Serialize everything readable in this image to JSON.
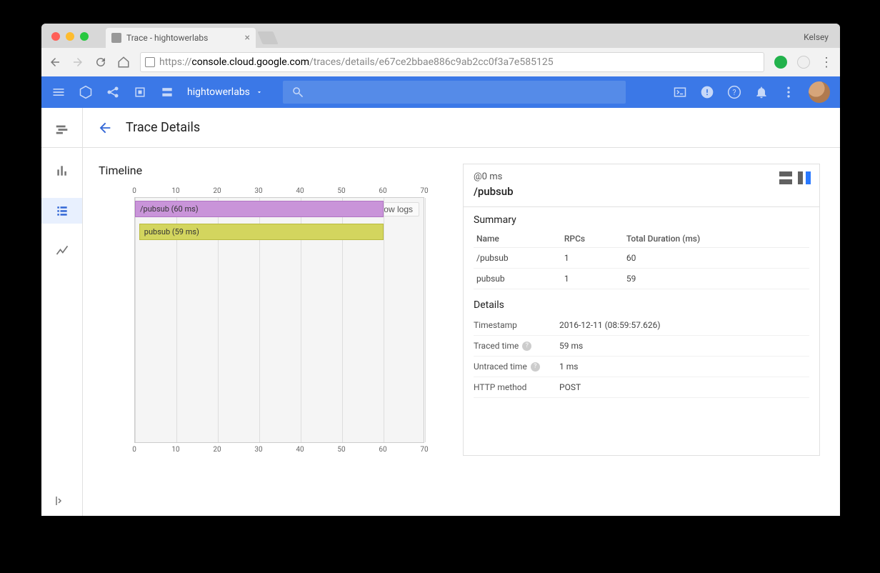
{
  "browser": {
    "tab_title": "Trace - hightowerlabs",
    "account": "Kelsey",
    "url_https": "https://",
    "url_host": "console.cloud.google.com",
    "url_path": "/traces/details/e67ce2bbae886c9ab2cc0f3a7e585125"
  },
  "topbar": {
    "project": "hightowerlabs"
  },
  "page": {
    "title": "Trace Details",
    "timeline_label": "Timeline"
  },
  "chart_data": {
    "type": "bar",
    "x_ticks": [
      "0",
      "10",
      "20",
      "30",
      "40",
      "50",
      "60",
      "70"
    ],
    "x_max": 70,
    "spans": [
      {
        "label": "/pubsub (60 ms)",
        "start": 0,
        "duration": 60,
        "depth": 0,
        "color": "purple"
      },
      {
        "label": "pubsub (59 ms)",
        "start": 1,
        "duration": 59,
        "depth": 1,
        "color": "yellow"
      }
    ],
    "show_logs_label": "Show logs"
  },
  "details": {
    "at": "@0 ms",
    "name": "/pubsub",
    "summary_title": "Summary",
    "summary_headers": [
      "Name",
      "RPCs",
      "Total Duration (ms)"
    ],
    "summary_rows": [
      {
        "name": "/pubsub",
        "rpcs": "1",
        "dur": "60"
      },
      {
        "name": "pubsub",
        "rpcs": "1",
        "dur": "59"
      }
    ],
    "details_title": "Details",
    "rows": [
      {
        "k": "Timestamp",
        "v": "2016-12-11 (08:59:57.626)",
        "help": false
      },
      {
        "k": "Traced time",
        "v": "59 ms",
        "help": true
      },
      {
        "k": "Untraced time",
        "v": "1 ms",
        "help": true
      },
      {
        "k": "HTTP method",
        "v": "POST",
        "help": false
      }
    ]
  }
}
